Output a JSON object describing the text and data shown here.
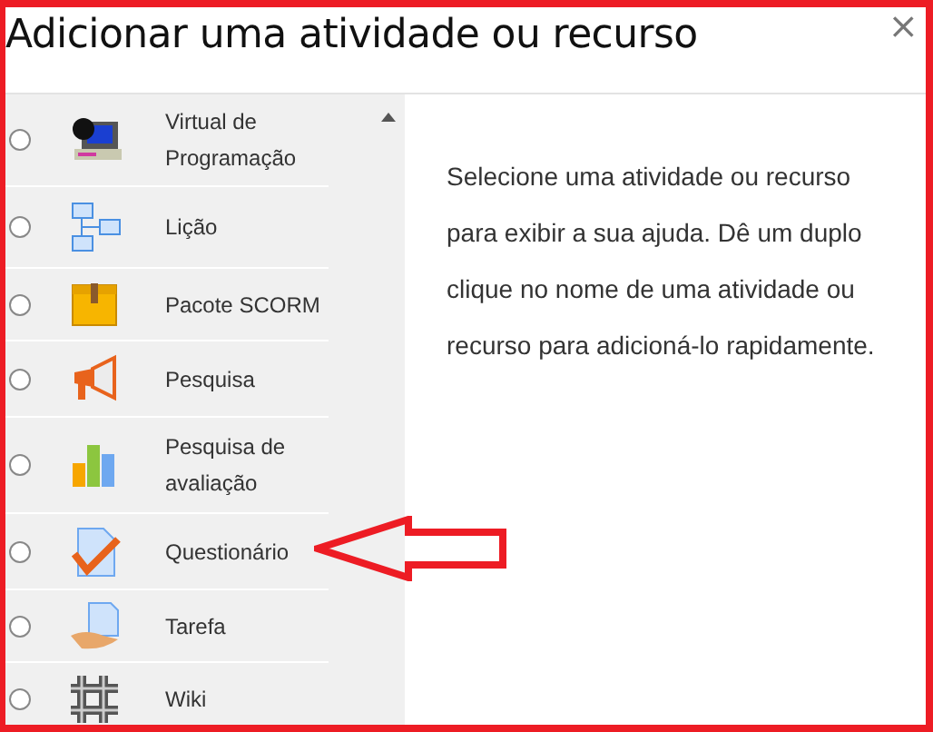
{
  "dialog": {
    "title": "Adicionar uma atividade ou recurso",
    "close": "×"
  },
  "items": [
    {
      "label": "Virtual de Programação",
      "kind": "lab",
      "selected": false
    },
    {
      "label": "Lição",
      "kind": "lesson",
      "selected": false
    },
    {
      "label": "Pacote SCORM",
      "kind": "scorm",
      "selected": false
    },
    {
      "label": "Pesquisa",
      "kind": "survey",
      "selected": false
    },
    {
      "label": "Pesquisa de avaliação",
      "kind": "feedback",
      "selected": false
    },
    {
      "label": "Questionário",
      "kind": "quiz",
      "selected": false
    },
    {
      "label": "Tarefa",
      "kind": "assign",
      "selected": false
    },
    {
      "label": "Wiki",
      "kind": "wiki",
      "selected": false
    }
  ],
  "help": "Selecione uma atividade ou recurso para exibir a sua ajuda. Dê um duplo clique no nome de uma atividade ou recurso para adicioná-lo rapidamente.",
  "annotation": {
    "kind": "arrow"
  }
}
